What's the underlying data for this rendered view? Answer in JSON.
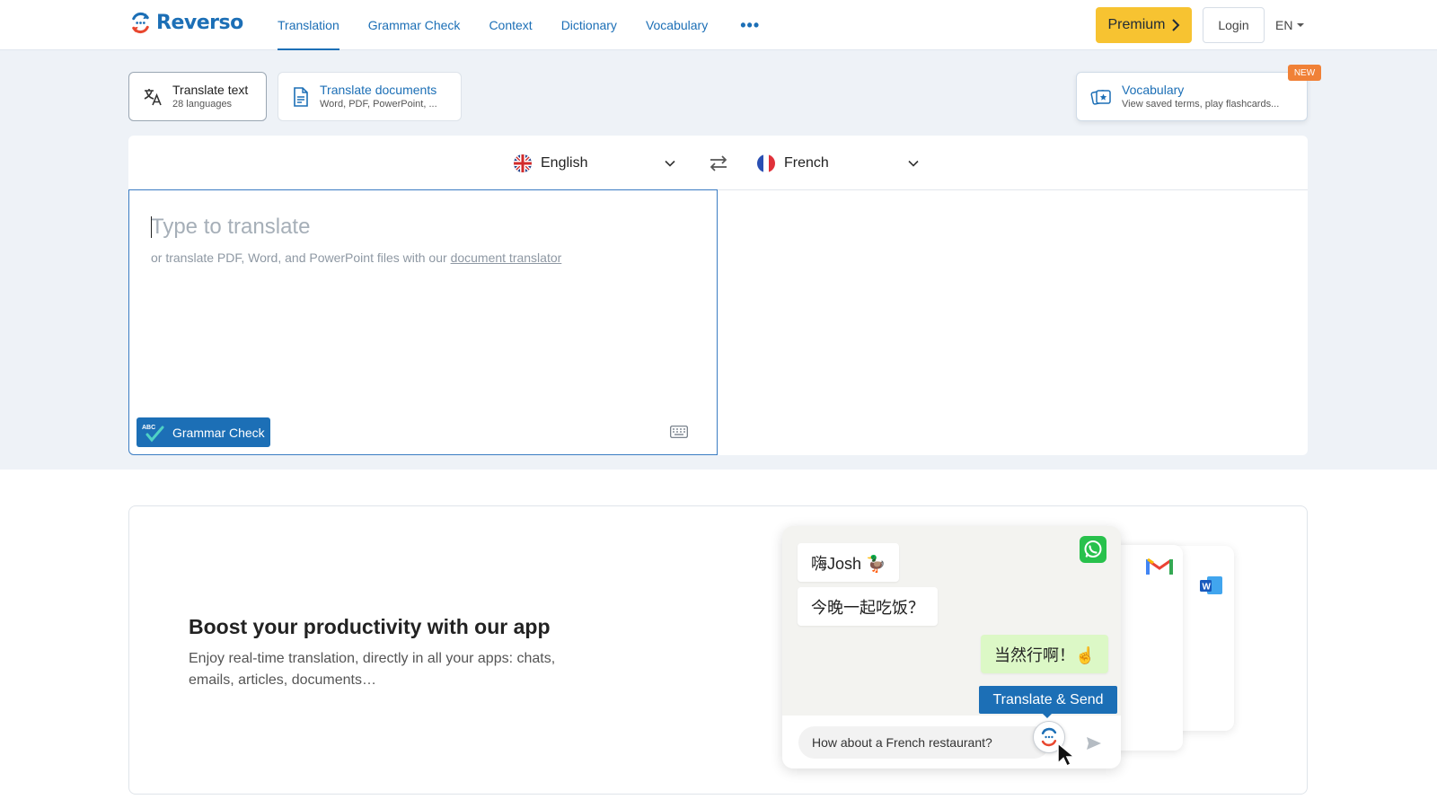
{
  "brand": {
    "name": "Reverso"
  },
  "nav": {
    "items": [
      {
        "label": "Translation",
        "active": true
      },
      {
        "label": "Grammar Check",
        "active": false
      },
      {
        "label": "Context",
        "active": false
      },
      {
        "label": "Dictionary",
        "active": false
      },
      {
        "label": "Vocabulary",
        "active": false
      }
    ],
    "more_label": "•••",
    "premium_label": "Premium",
    "login_label": "Login",
    "language_label": "EN"
  },
  "modes": {
    "translate_text": {
      "title": "Translate text",
      "subtitle": "28 languages"
    },
    "translate_documents": {
      "title": "Translate documents",
      "subtitle": "Word, PDF, PowerPoint, ..."
    },
    "vocabulary": {
      "title": "Vocabulary",
      "subtitle": "View saved terms, play flashcards...",
      "badge": "NEW"
    }
  },
  "translator": {
    "source_language": "English",
    "target_language": "French",
    "placeholder": "Type to translate",
    "hint_prefix": "or translate PDF, Word, and PowerPoint files with our ",
    "hint_link": "document translator",
    "grammar_button": "Grammar Check",
    "grammar_badge": "ABC"
  },
  "promo": {
    "title": "Boost your productivity with our app",
    "description": "Enjoy real-time translation, directly in all your apps: chats, emails, articles, documents…",
    "chat": {
      "messages": [
        {
          "text": "嗨Josh 🦆",
          "from": "other"
        },
        {
          "text": "今晚一起吃饭？",
          "from": "other"
        },
        {
          "text": "当然行啊！☝",
          "from": "me"
        }
      ],
      "input_text": "How about a French restaurant?",
      "translate_send_label": "Translate & Send"
    }
  },
  "colors": {
    "brand_blue": "#1c6fb6",
    "premium_yellow": "#f7c331",
    "new_badge": "#f08137",
    "band_background": "#eef2f7"
  }
}
